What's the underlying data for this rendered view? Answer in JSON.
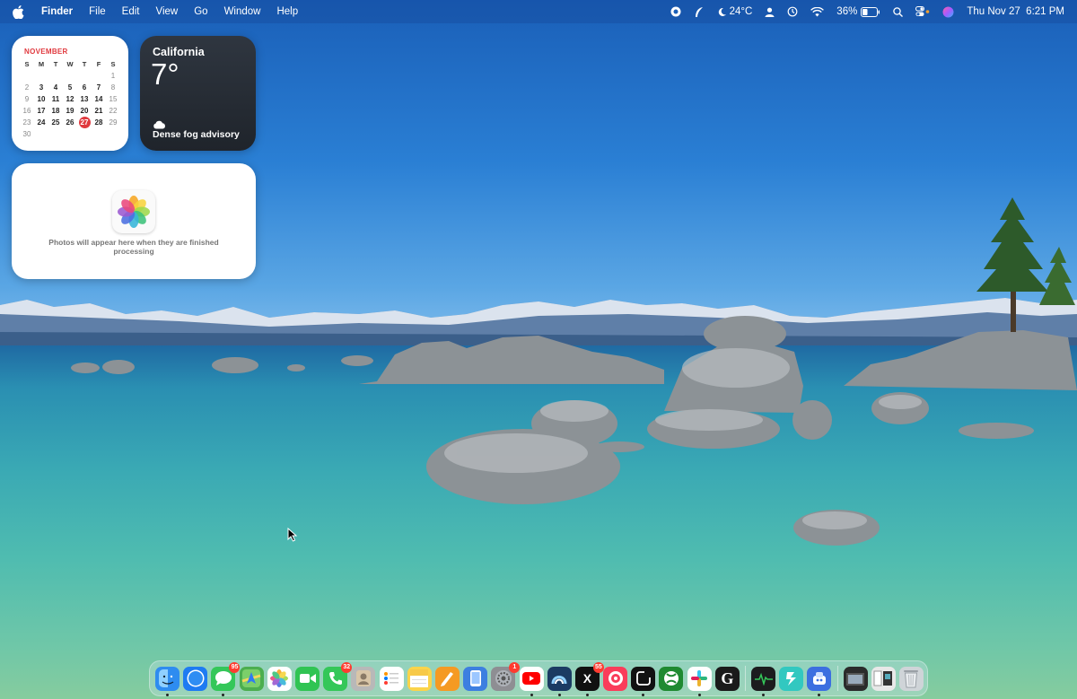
{
  "menubar": {
    "app_name": "Finder",
    "menus": [
      "File",
      "Edit",
      "View",
      "Go",
      "Window",
      "Help"
    ],
    "weather": "24°C",
    "battery": "36%",
    "clock": "Thu Nov 27  6:21 PM"
  },
  "calendar_widget": {
    "month": "NOVEMBER",
    "weekdays": [
      "S",
      "M",
      "T",
      "W",
      "T",
      "F",
      "S"
    ],
    "weeks": [
      [
        "",
        "",
        "",
        "",
        "",
        "",
        "1"
      ],
      [
        "2",
        "3",
        "4",
        "5",
        "6",
        "7",
        "8"
      ],
      [
        "9",
        "10",
        "11",
        "12",
        "13",
        "14",
        "15"
      ],
      [
        "16",
        "17",
        "18",
        "19",
        "20",
        "21",
        "22"
      ],
      [
        "23",
        "24",
        "25",
        "26",
        "27",
        "28",
        "29"
      ],
      [
        "30",
        "",
        "",
        "",
        "",
        "",
        ""
      ]
    ],
    "today": "27"
  },
  "weather_widget": {
    "location": "California",
    "temperature": "7°",
    "condition": "Dense fog advisory"
  },
  "photos_widget": {
    "message": "Photos will appear here when they are finished processing"
  },
  "dock": {
    "items": [
      {
        "name": "finder",
        "color": "#2e8cf0",
        "badge": "",
        "running": true
      },
      {
        "name": "safari",
        "color": "#1e7bf2",
        "badge": "",
        "running": false
      },
      {
        "name": "messages",
        "color": "#34c759",
        "badge": "95",
        "running": true
      },
      {
        "name": "maps",
        "color": "#4cae4f",
        "badge": "",
        "running": false
      },
      {
        "name": "photos",
        "color": "#ffffff",
        "badge": "",
        "running": false
      },
      {
        "name": "facetime",
        "color": "#30c453",
        "badge": "",
        "running": false
      },
      {
        "name": "phone",
        "color": "#34c759",
        "badge": "32",
        "running": false
      },
      {
        "name": "contacts",
        "color": "#b8b8b8",
        "badge": "",
        "running": false
      },
      {
        "name": "reminders",
        "color": "#ffffff",
        "badge": "",
        "running": false
      },
      {
        "name": "notes",
        "color": "#fbd44a",
        "badge": "",
        "running": false
      },
      {
        "name": "pages",
        "color": "#f59a23",
        "badge": "",
        "running": false
      },
      {
        "name": "simulator",
        "color": "#3d7fe0",
        "badge": "",
        "running": false
      },
      {
        "name": "system-settings",
        "color": "#8e8e93",
        "badge": "1",
        "running": false
      },
      {
        "name": "youtube",
        "color": "#ffffff",
        "badge": "",
        "running": true
      },
      {
        "name": "arc",
        "color": "#1b3b63",
        "badge": "",
        "running": true
      },
      {
        "name": "x",
        "color": "#111111",
        "badge": "55",
        "running": true
      },
      {
        "name": "music",
        "color": "#fa3c5a",
        "badge": "",
        "running": false
      },
      {
        "name": "capcut",
        "color": "#111111",
        "badge": "",
        "running": true
      },
      {
        "name": "xbox",
        "color": "#1f8a31",
        "badge": "",
        "running": false
      },
      {
        "name": "slack",
        "color": "#ffffff",
        "badge": "",
        "running": true
      },
      {
        "name": "grammarly",
        "color": "#1a1a1a",
        "badge": "",
        "running": false
      },
      {
        "name": "activity-monitor",
        "color": "#1c1c1e",
        "badge": "",
        "running": true
      },
      {
        "name": "shortcuts",
        "color": "#32c8c0",
        "badge": "",
        "running": false
      },
      {
        "name": "ai-app",
        "color": "#3c6fe0",
        "badge": "",
        "running": true
      },
      {
        "name": "screenshot-stack",
        "color": "#2b2b2b",
        "badge": "",
        "running": false
      },
      {
        "name": "downloads-stack",
        "color": "#e8e8e8",
        "badge": "",
        "running": false
      },
      {
        "name": "trash",
        "color": "#cfd4d8",
        "badge": "",
        "running": false
      }
    ]
  },
  "glyphs": {
    "grammarly": "G",
    "x": "X"
  }
}
